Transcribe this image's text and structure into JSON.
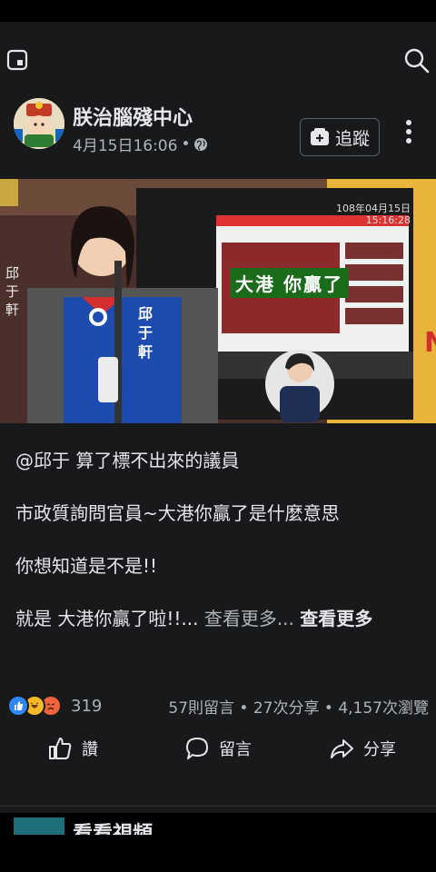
{
  "page": {
    "name": "朕治腦殘中心",
    "date": "4月15日16:06",
    "separator": "•",
    "follow_label": "追蹤"
  },
  "video": {
    "timestamp_date": "108年04月15日",
    "timestamp_time": "15:16:28",
    "overlay_text": "大港 你贏了",
    "side_label": "邱于軒",
    "vest_label": "邱于軒"
  },
  "post": {
    "line1": "@邱于  算了標不出來的議員",
    "line2": "市政質詢問官員~大港你贏了是什麼意思",
    "line3": "你想知道是不是!!",
    "line4": "就是 大港你贏了啦!!... ",
    "see_more": "查看更多... ",
    "see_more_bold": "查看更多"
  },
  "engagement": {
    "reaction_count": "319",
    "stats": "57則留言 • 27次分享 • 4,157次瀏覽"
  },
  "actions": {
    "like": "讚",
    "comment": "留言",
    "share": "分享"
  },
  "next_post": {
    "title": "看看視頻"
  },
  "colors": {
    "background": "#18191a",
    "text": "#e4e6eb",
    "muted": "#b0b3b8",
    "like_blue": "#2d88ff",
    "angry_orange": "#f0643c",
    "haha_yellow": "#f7b928"
  }
}
